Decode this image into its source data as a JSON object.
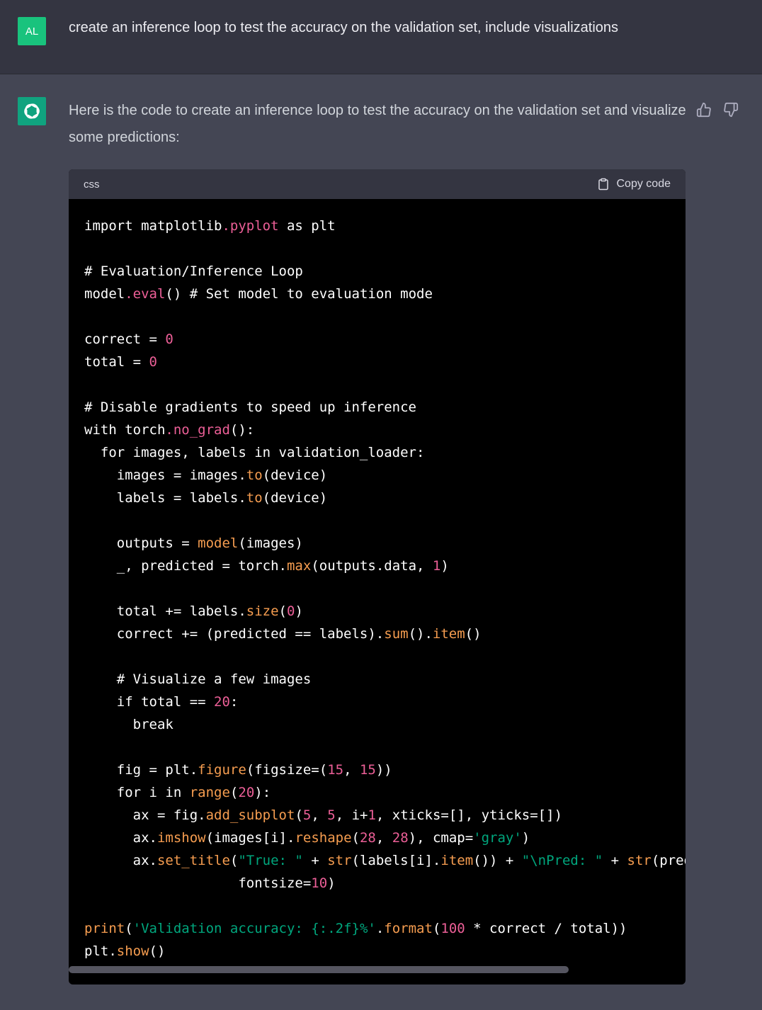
{
  "user": {
    "avatar_initials": "AL",
    "message": "create an inference loop to test the accuracy on the validation set, include visualizations"
  },
  "assistant": {
    "message": "Here is the code to create an inference loop to test the accuracy on the validation set and visualize some predictions:"
  },
  "code_block": {
    "language": "css",
    "copy_label": "Copy code",
    "lines": [
      [
        {
          "t": "k",
          "v": "import matplotlib"
        },
        {
          "t": "p",
          "v": ".pyplot"
        },
        {
          "t": "k",
          "v": " as plt"
        }
      ],
      [],
      [
        {
          "t": "k",
          "v": "# Evaluation/Inference Loop"
        }
      ],
      [
        {
          "t": "k",
          "v": "model"
        },
        {
          "t": "p",
          "v": ".eval"
        },
        {
          "t": "k",
          "v": "() # Set model to evaluation mode"
        }
      ],
      [],
      [
        {
          "t": "k",
          "v": "correct = "
        },
        {
          "t": "n",
          "v": "0"
        }
      ],
      [
        {
          "t": "k",
          "v": "total = "
        },
        {
          "t": "n",
          "v": "0"
        }
      ],
      [],
      [
        {
          "t": "k",
          "v": "# Disable gradients to speed up inference"
        }
      ],
      [
        {
          "t": "k",
          "v": "with torch"
        },
        {
          "t": "p",
          "v": ".no_grad"
        },
        {
          "t": "k",
          "v": "():"
        }
      ],
      [
        {
          "t": "k",
          "v": "  for images, labels in validation_loader:"
        }
      ],
      [
        {
          "t": "k",
          "v": "    images = images."
        },
        {
          "t": "f",
          "v": "to"
        },
        {
          "t": "k",
          "v": "(device)"
        }
      ],
      [
        {
          "t": "k",
          "v": "    labels = labels."
        },
        {
          "t": "f",
          "v": "to"
        },
        {
          "t": "k",
          "v": "(device)"
        }
      ],
      [],
      [
        {
          "t": "k",
          "v": "    outputs = "
        },
        {
          "t": "f",
          "v": "model"
        },
        {
          "t": "k",
          "v": "(images)"
        }
      ],
      [
        {
          "t": "k",
          "v": "    _, predicted = torch."
        },
        {
          "t": "f",
          "v": "max"
        },
        {
          "t": "k",
          "v": "(outputs.data, "
        },
        {
          "t": "n",
          "v": "1"
        },
        {
          "t": "k",
          "v": ")"
        }
      ],
      [],
      [
        {
          "t": "k",
          "v": "    total += labels."
        },
        {
          "t": "f",
          "v": "size"
        },
        {
          "t": "k",
          "v": "("
        },
        {
          "t": "n",
          "v": "0"
        },
        {
          "t": "k",
          "v": ")"
        }
      ],
      [
        {
          "t": "k",
          "v": "    correct += (predicted == labels)."
        },
        {
          "t": "f",
          "v": "sum"
        },
        {
          "t": "k",
          "v": "()."
        },
        {
          "t": "f",
          "v": "item"
        },
        {
          "t": "k",
          "v": "()"
        }
      ],
      [],
      [
        {
          "t": "k",
          "v": "    # Visualize a few images"
        }
      ],
      [
        {
          "t": "k",
          "v": "    if total == "
        },
        {
          "t": "n",
          "v": "20"
        },
        {
          "t": "k",
          "v": ":"
        }
      ],
      [
        {
          "t": "k",
          "v": "      break"
        }
      ],
      [],
      [
        {
          "t": "k",
          "v": "    fig = plt."
        },
        {
          "t": "f",
          "v": "figure"
        },
        {
          "t": "k",
          "v": "(figsize=("
        },
        {
          "t": "n",
          "v": "15"
        },
        {
          "t": "k",
          "v": ", "
        },
        {
          "t": "n",
          "v": "15"
        },
        {
          "t": "k",
          "v": "))"
        }
      ],
      [
        {
          "t": "k",
          "v": "    for i in "
        },
        {
          "t": "f",
          "v": "range"
        },
        {
          "t": "k",
          "v": "("
        },
        {
          "t": "n",
          "v": "20"
        },
        {
          "t": "k",
          "v": "):"
        }
      ],
      [
        {
          "t": "k",
          "v": "      ax = fig."
        },
        {
          "t": "f",
          "v": "add_subplot"
        },
        {
          "t": "k",
          "v": "("
        },
        {
          "t": "n",
          "v": "5"
        },
        {
          "t": "k",
          "v": ", "
        },
        {
          "t": "n",
          "v": "5"
        },
        {
          "t": "k",
          "v": ", i+"
        },
        {
          "t": "n",
          "v": "1"
        },
        {
          "t": "k",
          "v": ", xticks=[], yticks=[])"
        }
      ],
      [
        {
          "t": "k",
          "v": "      ax."
        },
        {
          "t": "f",
          "v": "imshow"
        },
        {
          "t": "k",
          "v": "(images[i]."
        },
        {
          "t": "f",
          "v": "reshape"
        },
        {
          "t": "k",
          "v": "("
        },
        {
          "t": "n",
          "v": "28"
        },
        {
          "t": "k",
          "v": ", "
        },
        {
          "t": "n",
          "v": "28"
        },
        {
          "t": "k",
          "v": "), cmap="
        },
        {
          "t": "s",
          "v": "'gray'"
        },
        {
          "t": "k",
          "v": ")"
        }
      ],
      [
        {
          "t": "k",
          "v": "      ax."
        },
        {
          "t": "f",
          "v": "set_title"
        },
        {
          "t": "k",
          "v": "("
        },
        {
          "t": "s",
          "v": "\"True: \""
        },
        {
          "t": "k",
          "v": " + "
        },
        {
          "t": "f",
          "v": "str"
        },
        {
          "t": "k",
          "v": "(labels[i]."
        },
        {
          "t": "f",
          "v": "item"
        },
        {
          "t": "k",
          "v": "()) + "
        },
        {
          "t": "s",
          "v": "\"\\nPred: \""
        },
        {
          "t": "k",
          "v": " + "
        },
        {
          "t": "f",
          "v": "str"
        },
        {
          "t": "k",
          "v": "(predi"
        }
      ],
      [
        {
          "t": "k",
          "v": "                   fontsize="
        },
        {
          "t": "n",
          "v": "10"
        },
        {
          "t": "k",
          "v": ")"
        }
      ],
      [],
      [
        {
          "t": "f",
          "v": "print"
        },
        {
          "t": "k",
          "v": "("
        },
        {
          "t": "s",
          "v": "'Validation accuracy: {:.2f}%'"
        },
        {
          "t": "k",
          "v": "."
        },
        {
          "t": "f",
          "v": "format"
        },
        {
          "t": "k",
          "v": "("
        },
        {
          "t": "n",
          "v": "100"
        },
        {
          "t": "k",
          "v": " * correct / total))"
        }
      ],
      [
        {
          "t": "k",
          "v": "plt."
        },
        {
          "t": "f",
          "v": "show"
        },
        {
          "t": "k",
          "v": "()"
        }
      ]
    ]
  },
  "scrollbar": {
    "thumb_fraction": 0.81
  }
}
